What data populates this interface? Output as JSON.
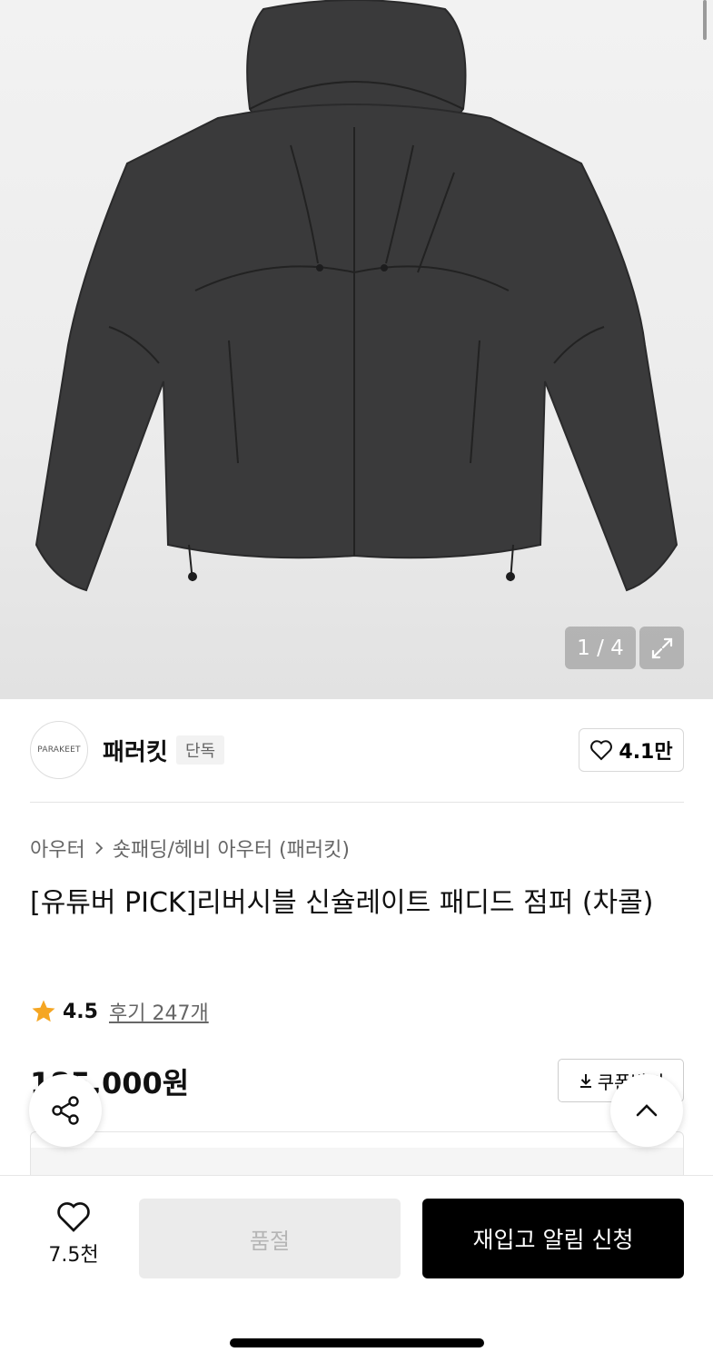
{
  "gallery": {
    "counter": "1 / 4",
    "image_alt": "charcoal padded hooded jumper"
  },
  "brand": {
    "logo_text": "PARAKEET",
    "name": "패러킷",
    "badge": "단독",
    "likes": "4.1만"
  },
  "breadcrumb": {
    "category": "아우터",
    "subcategory": "숏패딩/헤비 아우터 (패러킷)"
  },
  "product": {
    "title": "[유튜버 PICK]리버시블 신슐레이트 패디드 점퍼 (차콜)",
    "rating": "4.5",
    "reviews": "후기 247개",
    "price": "185,000원",
    "coupon_label": "쿠폰받기"
  },
  "bottom_bar": {
    "wish_count": "7.5천",
    "soldout_label": "품절",
    "restock_label": "재입고 알림 신청"
  },
  "colors": {
    "accent_star": "#F5A623",
    "primary_button": "#000000",
    "disabled_button": "#EBEBEB"
  }
}
